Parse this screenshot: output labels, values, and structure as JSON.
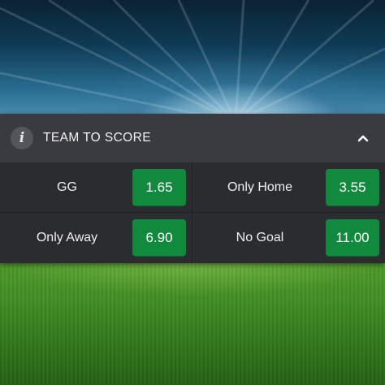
{
  "market": {
    "title": "TEAM TO SCORE",
    "info_icon": "info-icon",
    "toggle_icon": "chevron-up-icon"
  },
  "selections": [
    {
      "label": "GG",
      "odds": "1.65"
    },
    {
      "label": "Only Home",
      "odds": "3.55"
    },
    {
      "label": "Only Away",
      "odds": "6.90"
    },
    {
      "label": "No Goal",
      "odds": "11.00"
    }
  ],
  "colors": {
    "odds_button": "#128a3e",
    "panel": "#2b2c30",
    "header": "#3a3b40"
  }
}
